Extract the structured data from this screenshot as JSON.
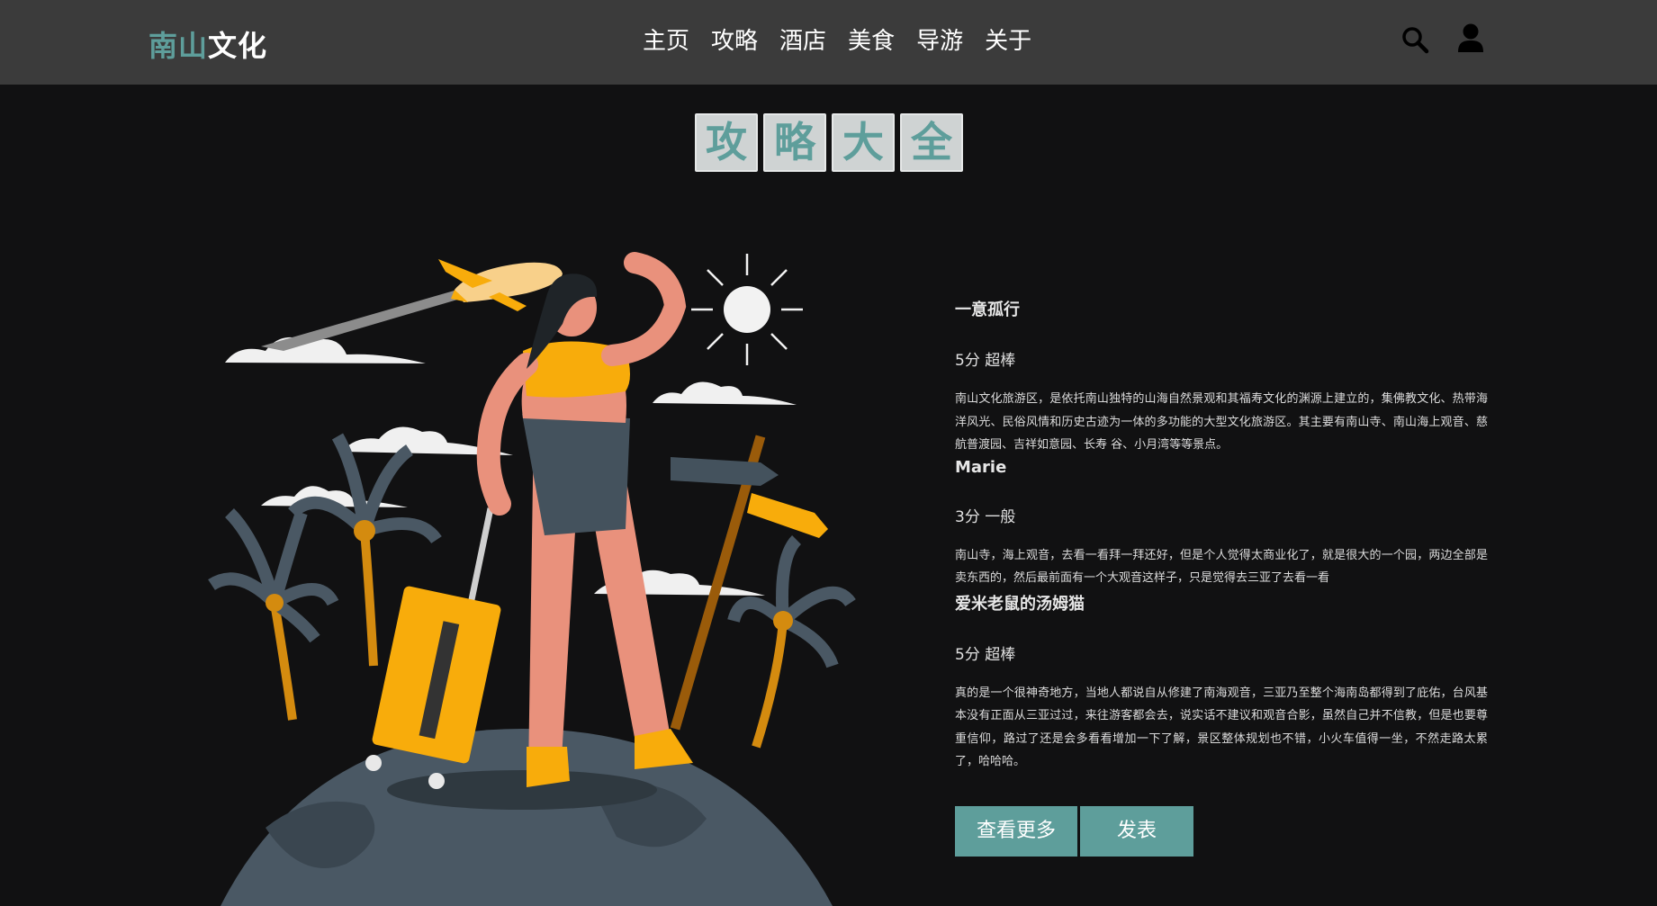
{
  "header": {
    "logo_part1": "南山",
    "logo_part2": "文化",
    "nav": [
      "主页",
      "攻略",
      "酒店",
      "美食",
      "导游",
      "关于"
    ]
  },
  "title_chars": [
    "攻",
    "略",
    "大",
    "全"
  ],
  "reviews": [
    {
      "author": "一意孤行",
      "rating": "5分 超棒",
      "text": "南山文化旅游区，是依托南山独特的山海自然景观和其福寿文化的渊源上建立的，集佛教文化、热带海洋风光、民俗风情和历史古迹为一体的多功能的大型文化旅游区。其主要有南山寺、南山海上观音、慈航普渡园、吉祥如意园、长寿 谷、小月湾等等景点。"
    },
    {
      "author": "Marie",
      "rating": "3分 一般",
      "text": "南山寺，海上观音，去看一看拜一拜还好，但是个人觉得太商业化了，就是很大的一个园，两边全部是卖东西的，然后最前面有一个大观音这样子，只是觉得去三亚了去看一看"
    },
    {
      "author": "爱米老鼠的汤姆猫",
      "rating": "5分 超棒",
      "text": "真的是一个很神奇地方，当地人都说自从修建了南海观音，三亚乃至整个海南岛都得到了庇佑，台风基本没有正面从三亚过过，来往游客都会去，说实话不建议和观音合影，虽然自己并不信教，但是也要尊重信仰，路过了还是会多看看增加一下了解，景区整体规划也不错，小火车值得一坐，不然走路太累了，哈哈哈。"
    }
  ],
  "buttons": {
    "more": "查看更多",
    "post": "发表"
  },
  "icons": {
    "search": "search-icon",
    "user": "user-icon"
  },
  "colors": {
    "accent": "#5e9e9b",
    "header_bg": "#3b3b3b",
    "page_bg": "#111112",
    "illustration_yellow": "#f8ac0b",
    "illustration_skin": "#e9917c"
  }
}
